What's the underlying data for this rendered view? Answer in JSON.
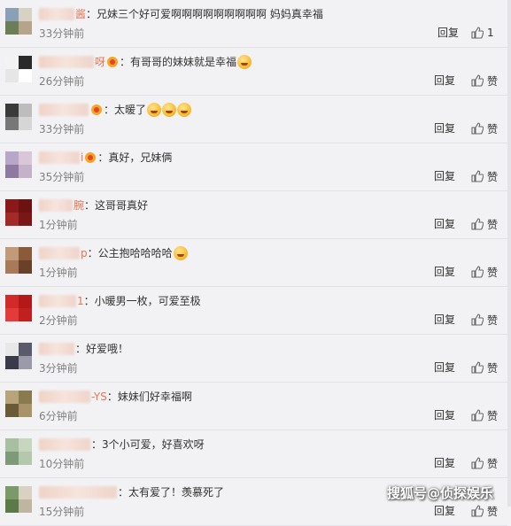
{
  "colors": {
    "username": "#eb7350",
    "text": "#333333",
    "time": "#808080",
    "background": "#f2f2f5"
  },
  "comments": [
    {
      "user_suffix": "酱",
      "text": "兄妹三个好可爱啊啊啊啊啊啊啊啊啊 妈妈真幸福",
      "time": "33分钟前",
      "reply": "回复",
      "like": "1",
      "vip": false,
      "emojis": 0
    },
    {
      "user_suffix": "呀",
      "text": "有哥哥的妹妹就是幸福",
      "time": "26分钟前",
      "reply": "回复",
      "like": "赞",
      "vip": true,
      "emojis": 1
    },
    {
      "user_suffix": "",
      "text": "太暖了",
      "time": "33分钟前",
      "reply": "回复",
      "like": "赞",
      "vip": true,
      "emojis": 3
    },
    {
      "user_suffix": "i",
      "text": "真好，兄妹俩",
      "time": "35分钟前",
      "reply": "回复",
      "like": "赞",
      "vip": true,
      "emojis": 0
    },
    {
      "user_suffix": "腕",
      "text": "这哥哥真好",
      "time": "1分钟前",
      "reply": "回复",
      "like": "赞",
      "vip": false,
      "emojis": 0
    },
    {
      "user_suffix": "p",
      "text": "公主抱哈哈哈哈",
      "time": "1分钟前",
      "reply": "回复",
      "like": "赞",
      "vip": false,
      "emojis": 1
    },
    {
      "user_suffix": "1",
      "text": "小暖男一枚，可爱至极",
      "time": "2分钟前",
      "reply": "回复",
      "like": "赞",
      "vip": false,
      "emojis": 0
    },
    {
      "user_suffix": "",
      "text": "好爱哦！",
      "time": "3分钟前",
      "reply": "回复",
      "like": "赞",
      "vip": false,
      "emojis": 0
    },
    {
      "user_suffix": "-YS",
      "text": "妹妹们好幸福啊",
      "time": "6分钟前",
      "reply": "回复",
      "like": "赞",
      "vip": false,
      "emojis": 0
    },
    {
      "user_suffix": "",
      "text": "3个小可爱，好喜欢呀",
      "time": "10分钟前",
      "reply": "回复",
      "like": "赞",
      "vip": false,
      "emojis": 0
    },
    {
      "user_suffix": "",
      "text": "太有爱了！羡慕死了",
      "time": "15分钟前",
      "reply": "回复",
      "like": "赞",
      "vip": false,
      "emojis": 0
    }
  ],
  "watermark": "搜狐号@侦探娱乐"
}
